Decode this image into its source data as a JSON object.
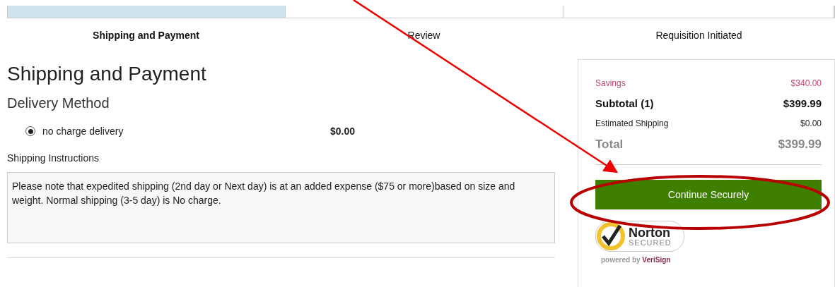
{
  "progress": {
    "steps": [
      {
        "label": "Shipping and Payment",
        "selected": true
      },
      {
        "label": "Review",
        "selected": false
      },
      {
        "label": "Requisition Initiated",
        "selected": false
      }
    ]
  },
  "main": {
    "title": "Shipping and Payment",
    "subtitle": "Delivery Method",
    "delivery_options": [
      {
        "label": "no charge delivery",
        "price": "$0.00",
        "selected": true
      }
    ],
    "instructions_label": "Shipping Instructions",
    "instructions_text": "Please note that expedited shipping (2nd day or Next day) is at an added expense ($75 or more)based on size and weight.  Normal shipping (3-5 day) is No charge."
  },
  "summary": {
    "rows": [
      {
        "kind": "savings",
        "label": "Savings",
        "value": "$340.00"
      },
      {
        "kind": "subtotal",
        "label": "Subtotal (1)",
        "value": "$399.99"
      },
      {
        "kind": "shipping",
        "label": "Estimated Shipping",
        "value": "$0.00"
      },
      {
        "kind": "total",
        "label": "Total",
        "value": "$399.99"
      }
    ],
    "button": "Continue Securely",
    "seal": {
      "brand": "Norton",
      "status": "SECURED",
      "powered_prefix": "powered by",
      "powered_brand": "VeriSign"
    }
  }
}
